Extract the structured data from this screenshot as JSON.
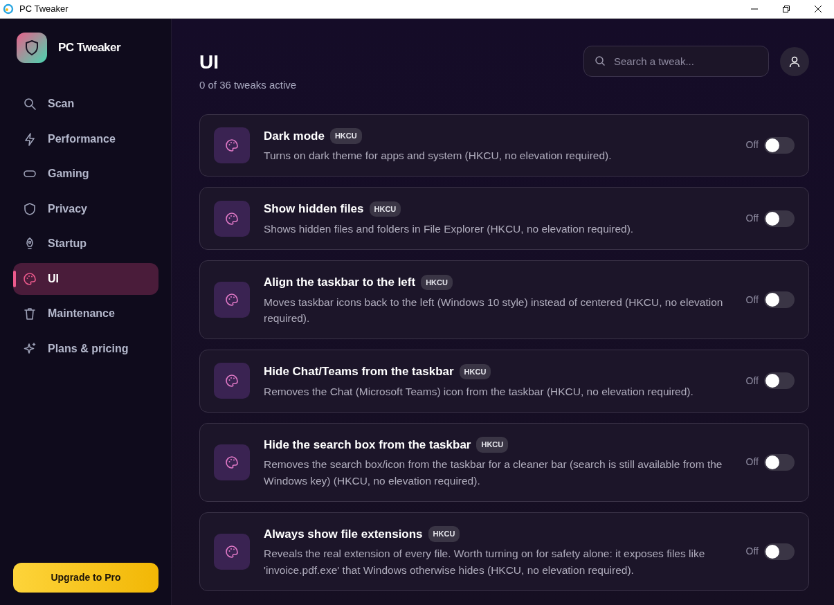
{
  "window": {
    "title": "PC Tweaker"
  },
  "sidebar": {
    "brand": "PC Tweaker",
    "items": [
      {
        "label": "Scan",
        "kind": "search",
        "selected": false
      },
      {
        "label": "Performance",
        "kind": "bolt",
        "selected": false
      },
      {
        "label": "Gaming",
        "kind": "gamepad",
        "selected": false
      },
      {
        "label": "Privacy",
        "kind": "shield",
        "selected": false
      },
      {
        "label": "Startup",
        "kind": "rocket",
        "selected": false
      },
      {
        "label": "UI",
        "kind": "palette",
        "selected": true
      },
      {
        "label": "Maintenance",
        "kind": "trash",
        "selected": false
      },
      {
        "label": "Plans & pricing",
        "kind": "sparkle",
        "selected": false
      }
    ],
    "upgrade_button": "Upgrade to Pro"
  },
  "header": {
    "title": "UI",
    "subtitle": "0 of 36 tweaks active",
    "search": {
      "placeholder": "Search a tweak..."
    }
  },
  "tweaks": [
    {
      "title": "Dark mode",
      "badge": "HKCU",
      "description": "Turns on dark theme for apps and system (HKCU, no elevation required).",
      "state_label": "Off",
      "on": false
    },
    {
      "title": "Show hidden files",
      "badge": "HKCU",
      "description": "Shows hidden files and folders in File Explorer (HKCU, no elevation required).",
      "state_label": "Off",
      "on": false
    },
    {
      "title": "Align the taskbar to the left",
      "badge": "HKCU",
      "description": "Moves taskbar icons back to the left (Windows 10 style) instead of centered (HKCU, no elevation required).",
      "state_label": "Off",
      "on": false
    },
    {
      "title": "Hide Chat/Teams from the taskbar",
      "badge": "HKCU",
      "description": "Removes the Chat (Microsoft Teams) icon from the taskbar (HKCU, no elevation required).",
      "state_label": "Off",
      "on": false
    },
    {
      "title": "Hide the search box from the taskbar",
      "badge": "HKCU",
      "description": "Removes the search box/icon from the taskbar for a cleaner bar (search is still available from the Windows key) (HKCU, no elevation required).",
      "state_label": "Off",
      "on": false
    },
    {
      "title": "Always show file extensions",
      "badge": "HKCU",
      "description": "Reveals the real extension of every file. Worth turning on for safety alone: it exposes files like 'invoice.pdf.exe' that Windows otherwise hides (HKCU, no elevation required).",
      "state_label": "Off",
      "on": false
    }
  ]
}
